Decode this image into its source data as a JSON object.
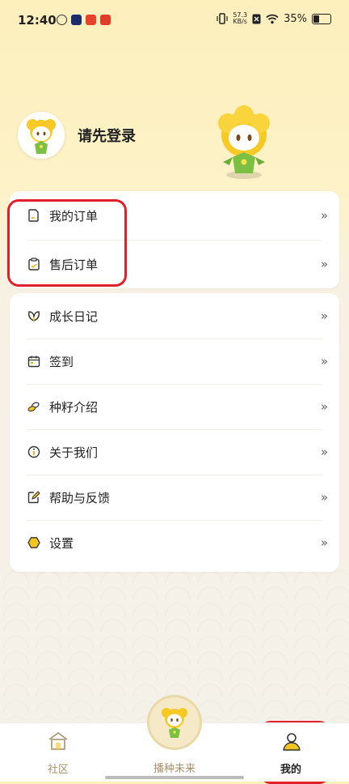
{
  "status_bar": {
    "time": "12:40",
    "net_speed_value": "57.3",
    "net_speed_unit": "KB/s",
    "battery": "35%"
  },
  "profile": {
    "login_prompt": "请先登录"
  },
  "orders_menu": [
    {
      "label": "我的订单",
      "icon": "document-icon"
    },
    {
      "label": "售后订单",
      "icon": "clipboard-icon"
    }
  ],
  "main_menu": [
    {
      "label": "成长日记",
      "icon": "leaf-icon"
    },
    {
      "label": "签到",
      "icon": "calendar-icon"
    },
    {
      "label": "种籽介绍",
      "icon": "seed-icon"
    },
    {
      "label": "关于我们",
      "icon": "info-icon"
    },
    {
      "label": "帮助与反馈",
      "icon": "edit-icon"
    },
    {
      "label": "设置",
      "icon": "hexagon-settings-icon"
    }
  ],
  "arrow_glyph": "»",
  "tab_bar": {
    "community": "社区",
    "center": "播种未来",
    "mine": "我的"
  },
  "colors": {
    "accent_highlight": "#e0202a",
    "tab_inactive": "#a88f6a",
    "header_bg": "#fdf0bd",
    "mascot_yellow": "#f7c925",
    "mascot_green": "#7bc043"
  }
}
